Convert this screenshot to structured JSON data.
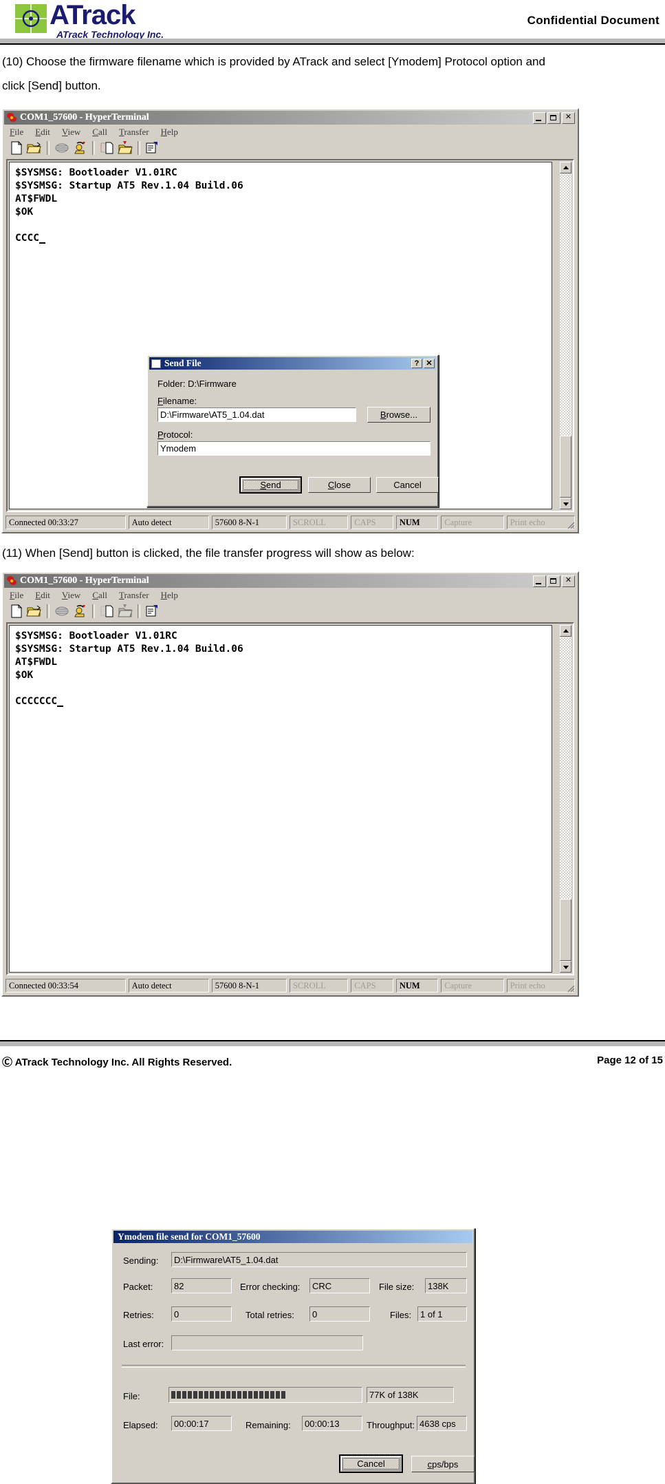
{
  "header": {
    "logo_text": "ATrack",
    "logo_sub": "ATrack Technology Inc.",
    "confidential": "Confidential  Document"
  },
  "body": {
    "para10_line1": "(10) Choose the firmware filename which is provided by ATrack and select [Ymodem] Protocol option and",
    "para10_line2": "click [Send] button.",
    "para11": "(11) When [Send] button is clicked, the file transfer progress will show as below:"
  },
  "window1": {
    "title": "COM1_57600 - HyperTerminal",
    "menu": [
      "File",
      "Edit",
      "View",
      "Call",
      "Transfer",
      "Help"
    ],
    "terminal_text": "$SYSMSG: Bootloader V1.01RC\n$SYSMSG: Startup AT5 Rev.1.04 Build.06\nAT$FWDL\n$OK\n\nCCCC",
    "status": {
      "connected": "Connected 00:33:27",
      "detect": "Auto detect",
      "line": "57600 8-N-1",
      "scroll": "SCROLL",
      "caps": "CAPS",
      "num": "NUM",
      "capture": "Capture",
      "printecho": "Print echo"
    }
  },
  "window2": {
    "title": "COM1_57600 - HyperTerminal",
    "menu": [
      "File",
      "Edit",
      "View",
      "Call",
      "Transfer",
      "Help"
    ],
    "terminal_text": "$SYSMSG: Bootloader V1.01RC\n$SYSMSG: Startup AT5 Rev.1.04 Build.06\nAT$FWDL\n$OK\n\nCCCCCCC",
    "status": {
      "connected": "Connected 00:33:54",
      "detect": "Auto detect",
      "line": "57600 8-N-1",
      "scroll": "SCROLL",
      "caps": "CAPS",
      "num": "NUM",
      "capture": "Capture",
      "printecho": "Print echo"
    }
  },
  "send_file_dialog": {
    "title": "Send File",
    "help_btn": "?",
    "close_btn": "✕",
    "folder_label": "Folder:  D:\\Firmware",
    "filename_label": "Filename:",
    "filename_value": "D:\\Firmware\\AT5_1.04.dat",
    "browse_label": "Browse...",
    "protocol_label": "Protocol:",
    "protocol_value": "Ymodem",
    "protocol_options": [
      "Ymodem"
    ],
    "send_label": "Send",
    "close_label": "Close",
    "cancel_label": "Cancel"
  },
  "ymodem_dialog": {
    "title": "Ymodem file send for COM1_57600",
    "sending_label": "Sending:",
    "sending_value": "D:\\Firmware\\AT5_1.04.dat",
    "packet_label": "Packet:",
    "packet_value": "82",
    "errorchecking_label": "Error checking:",
    "errorchecking_value": "CRC",
    "filesize_label": "File size:",
    "filesize_value": "138K",
    "retries_label": "Retries:",
    "retries_value": "0",
    "totalretries_label": "Total retries:",
    "totalretries_value": "0",
    "files_label": "Files:",
    "files_value": "1 of 1",
    "lasterror_label": "Last error:",
    "lasterror_value": "",
    "file_label": "File:",
    "file_progress_blocks": 21,
    "file_progress_value": "77K of 138K",
    "elapsed_label": "Elapsed:",
    "elapsed_value": "00:00:17",
    "remaining_label": "Remaining:",
    "remaining_value": "00:00:13",
    "throughput_label": "Throughput:",
    "throughput_value": "4638 cps",
    "cancel_label": "Cancel",
    "cpsbps_label": "cps/bps"
  },
  "footer": {
    "left": "Ⓒ ATrack Technology Inc. All Rights Reserved.",
    "right": "Page 12 of 15"
  }
}
